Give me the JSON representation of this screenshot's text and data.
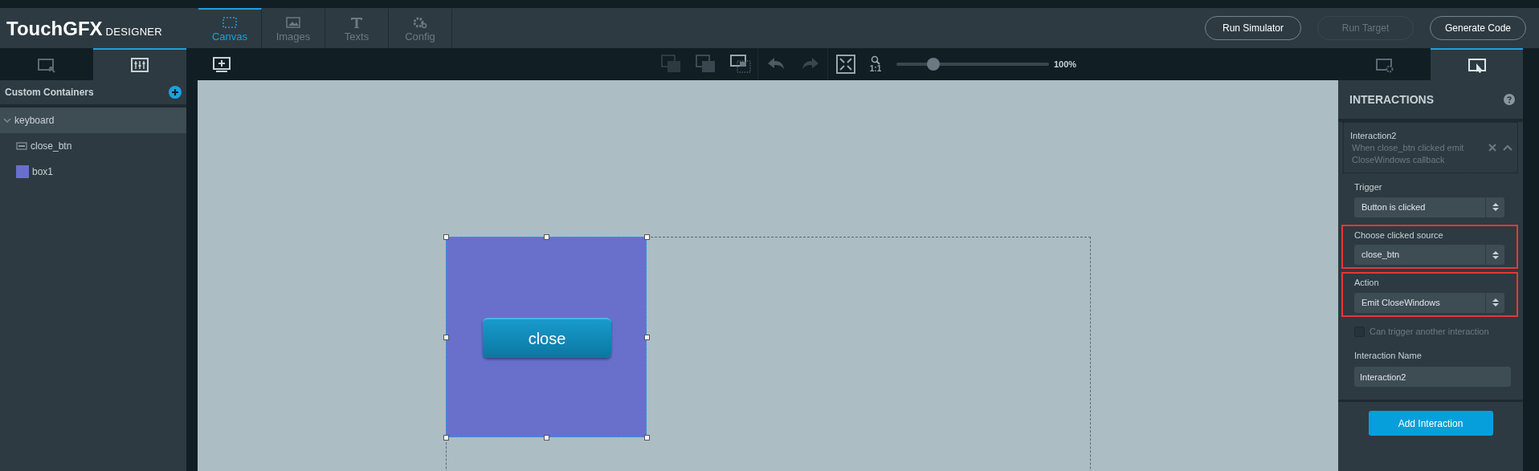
{
  "logo": {
    "brand": "TouchGFX",
    "product": "DESIGNER"
  },
  "nav_tabs": [
    {
      "label": "Canvas",
      "kind": "canvas",
      "selected": true
    },
    {
      "label": "Images",
      "kind": "images",
      "selected": false
    },
    {
      "label": "Texts",
      "kind": "texts",
      "selected": false
    },
    {
      "label": "Config",
      "kind": "config",
      "selected": false
    }
  ],
  "header_buttons": [
    {
      "label": "Run Simulator",
      "disabled": false
    },
    {
      "label": "Run Target",
      "disabled": true
    },
    {
      "label": "Generate Code",
      "disabled": false
    }
  ],
  "left_tabs": [
    {
      "kind": "screens",
      "selected": false
    },
    {
      "kind": "containers",
      "selected": true
    }
  ],
  "zoom": {
    "reset_label": "1:1",
    "level": 0.24,
    "reading": "100%"
  },
  "right_tabs": [
    {
      "kind": "properties",
      "selected": false
    },
    {
      "kind": "interactions",
      "selected": true
    }
  ],
  "sidebar": {
    "title": "Custom Containers",
    "tree": [
      {
        "label": "keyboard",
        "expanded": true,
        "selected": true,
        "children": [
          {
            "label": "close_btn",
            "kind": "button"
          },
          {
            "label": "box1",
            "kind": "box",
            "color": "#6870cc"
          }
        ]
      }
    ]
  },
  "canvas": {
    "button_label": "close"
  },
  "interactions": {
    "title": "INTERACTIONS",
    "item": {
      "name": "Interaction2",
      "summary": "When close_btn clicked emit CloseWindows callback"
    },
    "fields": [
      {
        "label": "Trigger",
        "value": "Button is clicked",
        "highlighted": false
      },
      {
        "label": "Choose clicked source",
        "value": "close_btn",
        "highlighted": true
      },
      {
        "label": "Action",
        "value": "Emit CloseWindows",
        "highlighted": true
      }
    ],
    "chain": {
      "label": "Can trigger another interaction",
      "checked": false
    },
    "name_field": {
      "label": "Interaction Name",
      "value": "Interaction2"
    },
    "add_button": "Add Interaction"
  }
}
